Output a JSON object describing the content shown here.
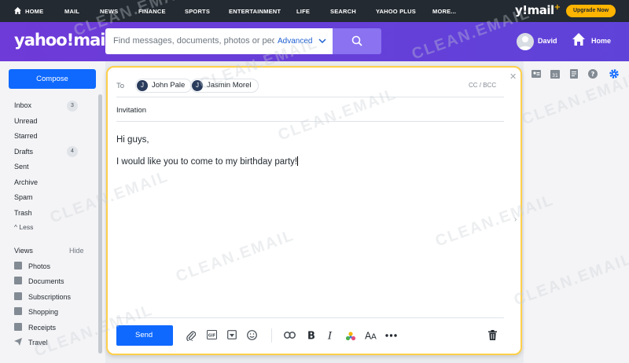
{
  "topnav": {
    "items": [
      "HOME",
      "MAIL",
      "NEWS",
      "FINANCE",
      "SPORTS",
      "ENTERTAINMENT",
      "LIFE",
      "SEARCH",
      "YAHOO PLUS",
      "MORE..."
    ],
    "logo": "y!mail",
    "upgrade_label": "Upgrade Now"
  },
  "header": {
    "brand": "yahoo!mail",
    "search_placeholder": "Find messages, documents, photos or peop",
    "advanced_label": "Advanced",
    "user_name": "David",
    "home_label": "Home"
  },
  "sidebar": {
    "compose_label": "Compose",
    "folders": [
      {
        "label": "Inbox",
        "count": "3"
      },
      {
        "label": "Unread",
        "count": ""
      },
      {
        "label": "Starred",
        "count": ""
      },
      {
        "label": "Drafts",
        "count": "4"
      },
      {
        "label": "Sent",
        "count": ""
      },
      {
        "label": "Archive",
        "count": ""
      },
      {
        "label": "Spam",
        "count": ""
      },
      {
        "label": "Trash",
        "count": ""
      }
    ],
    "less_label": "Less",
    "views_title": "Views",
    "hide_label": "Hide",
    "views": [
      "Photos",
      "Documents",
      "Subscriptions",
      "Shopping",
      "Receipts",
      "Travel"
    ]
  },
  "compose": {
    "to_label": "To",
    "recipients": [
      {
        "initial": "J",
        "name": "John Pale"
      },
      {
        "initial": "J",
        "name": "Jasmin Morel"
      }
    ],
    "cc_bcc_label": "CC / BCC",
    "subject": "Invitation",
    "body_line1": "Hi guys,",
    "body_line2": "I would like you to come to my birthday party!",
    "send_label": "Send"
  },
  "watermark": "CLEAN.EMAIL",
  "colors": {
    "purple": "#6e3ad8",
    "accent_blue": "#0f69ff",
    "compose_border": "#ffd04a",
    "upgrade": "#ffb400"
  }
}
